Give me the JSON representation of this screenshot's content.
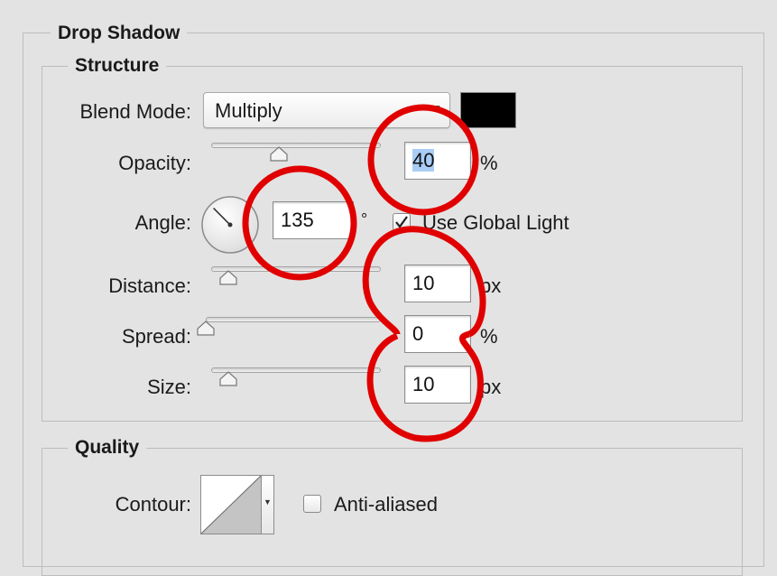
{
  "drop_shadow": {
    "title": "Drop Shadow"
  },
  "structure": {
    "title": "Structure",
    "blend_mode": {
      "label": "Blend Mode:",
      "value": "Multiply"
    },
    "shadow_color": "#000000",
    "opacity": {
      "label": "Opacity:",
      "value": "40",
      "unit": "%",
      "slider_fraction": 0.4
    },
    "angle": {
      "label": "Angle:",
      "value": "135",
      "unit": "°",
      "degrees": 135,
      "use_global_light": {
        "label": "Use Global Light",
        "checked": true
      }
    },
    "distance": {
      "label": "Distance:",
      "value": "10",
      "unit": "px",
      "slider_fraction": 0.1
    },
    "spread": {
      "label": "Spread:",
      "value": "0",
      "unit": "%",
      "slider_fraction": 0.0
    },
    "size": {
      "label": "Size:",
      "value": "10",
      "unit": "px",
      "slider_fraction": 0.1
    }
  },
  "quality": {
    "title": "Quality",
    "contour": {
      "label": "Contour:"
    },
    "anti_aliased": {
      "label": "Anti-aliased",
      "checked": false
    }
  },
  "annotation_color": "#e00000",
  "icons": {
    "select_arrow": "chevron-down-icon",
    "slider_thumb": "slider-thumb-icon",
    "angle_dial": "angle-dial-icon",
    "contour_preview": "contour-curve-icon"
  }
}
